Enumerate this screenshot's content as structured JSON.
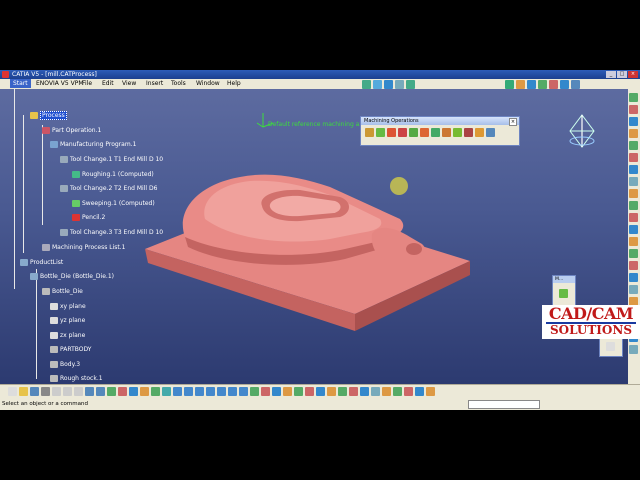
{
  "window": {
    "title": "CATIA V5 - [mill.CATProcess]"
  },
  "menu": {
    "start": "Start",
    "items": [
      "ENOVIA V5 VPM",
      "File",
      "Edit",
      "View",
      "Insert",
      "Tools",
      "Window",
      "Help"
    ]
  },
  "tree": {
    "process": "Process",
    "part_operation": "Part Operation.1",
    "program": "Manufacturing Program.1",
    "tool_change_1": "Tool Change.1  T1 End Mill D 10",
    "roughing": "Roughing.1 (Computed)",
    "tool_change_2": "Tool Change.2  T2 End Mill D6",
    "sweeping": "Sweeping.1 (Computed)",
    "pencil": "Pencil.2",
    "tool_change_3": "Tool Change.3  T3 End Mill D 10",
    "process_list": "Machining Process List.1",
    "product_list": "ProductList",
    "bottle_die_inst": "Bottle_Die (Bottle_Die.1)",
    "bottle_die": "Bottle_Die",
    "xy": "xy plane",
    "yz": "yz plane",
    "zx": "zx plane",
    "partbody": "PARTBODY",
    "body3": "Body.3",
    "rough_stock": "Rough stock.1"
  },
  "viewport": {
    "annotation": "Default reference machining axis"
  },
  "machining_toolbar": {
    "title": "Machining Operations"
  },
  "small_panel": {
    "title": "M..."
  },
  "small_panel_2": {
    "title": "M..."
  },
  "status": {
    "message": "Select an object or a command"
  },
  "logo": {
    "line1": "CAD/CAM",
    "line2": "SOLUTIONS"
  },
  "colors": {
    "part": "#e07c78",
    "background": "#3a4a7c",
    "selection": "#1f4fd0",
    "logo_red": "#c01a1a"
  }
}
